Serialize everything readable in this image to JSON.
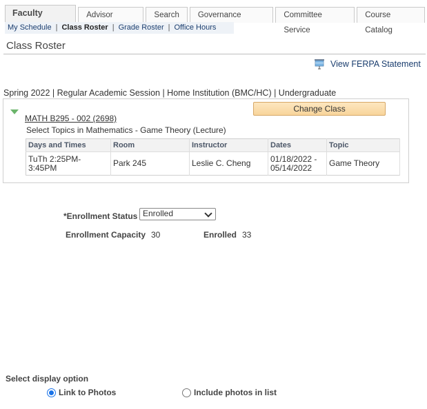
{
  "tabs": [
    {
      "label": "Faculty Center",
      "active": true
    },
    {
      "label": "Advisor Center",
      "active": false
    },
    {
      "label": "Search",
      "active": false
    },
    {
      "label": "Governance Profiles",
      "active": false
    },
    {
      "label": "Committee Service",
      "active": false
    },
    {
      "label": "Course Catalog",
      "active": false
    }
  ],
  "subnav": {
    "items": [
      "My Schedule",
      "Class Roster",
      "Grade Roster",
      "Office Hours"
    ],
    "separator": "|"
  },
  "page": {
    "title": "Class Roster",
    "ferpa_link": "View FERPA Statement",
    "term_line": "Spring 2022 | Regular Academic Session | Home Institution (BMC/HC) | Undergraduate"
  },
  "course": {
    "link": "MATH B295 - 002 (2698)",
    "description": "Select Topics in Mathematics - Game Theory (Lecture)",
    "change_button": "Change Class",
    "meeting_table": {
      "headers": [
        "Days and Times",
        "Room",
        "Instructor",
        "Dates",
        "Topic"
      ],
      "rows": [
        [
          "TuTh 2:25PM- 3:45PM",
          "Park 245",
          "Leslie C. Cheng",
          "01/18/2022 - 05/14/2022",
          "Game Theory"
        ]
      ]
    }
  },
  "enrollment": {
    "status_label": "*Enrollment Status",
    "status_value": "Enrolled",
    "capacity_label": "Enrollment Capacity",
    "capacity_value": "30",
    "enrolled_label": "Enrolled",
    "enrolled_value": "33"
  },
  "display": {
    "label": "Select display option",
    "options": [
      {
        "label": "Link to Photos",
        "selected": true
      },
      {
        "label": "Include photos in list",
        "selected": false
      }
    ]
  }
}
